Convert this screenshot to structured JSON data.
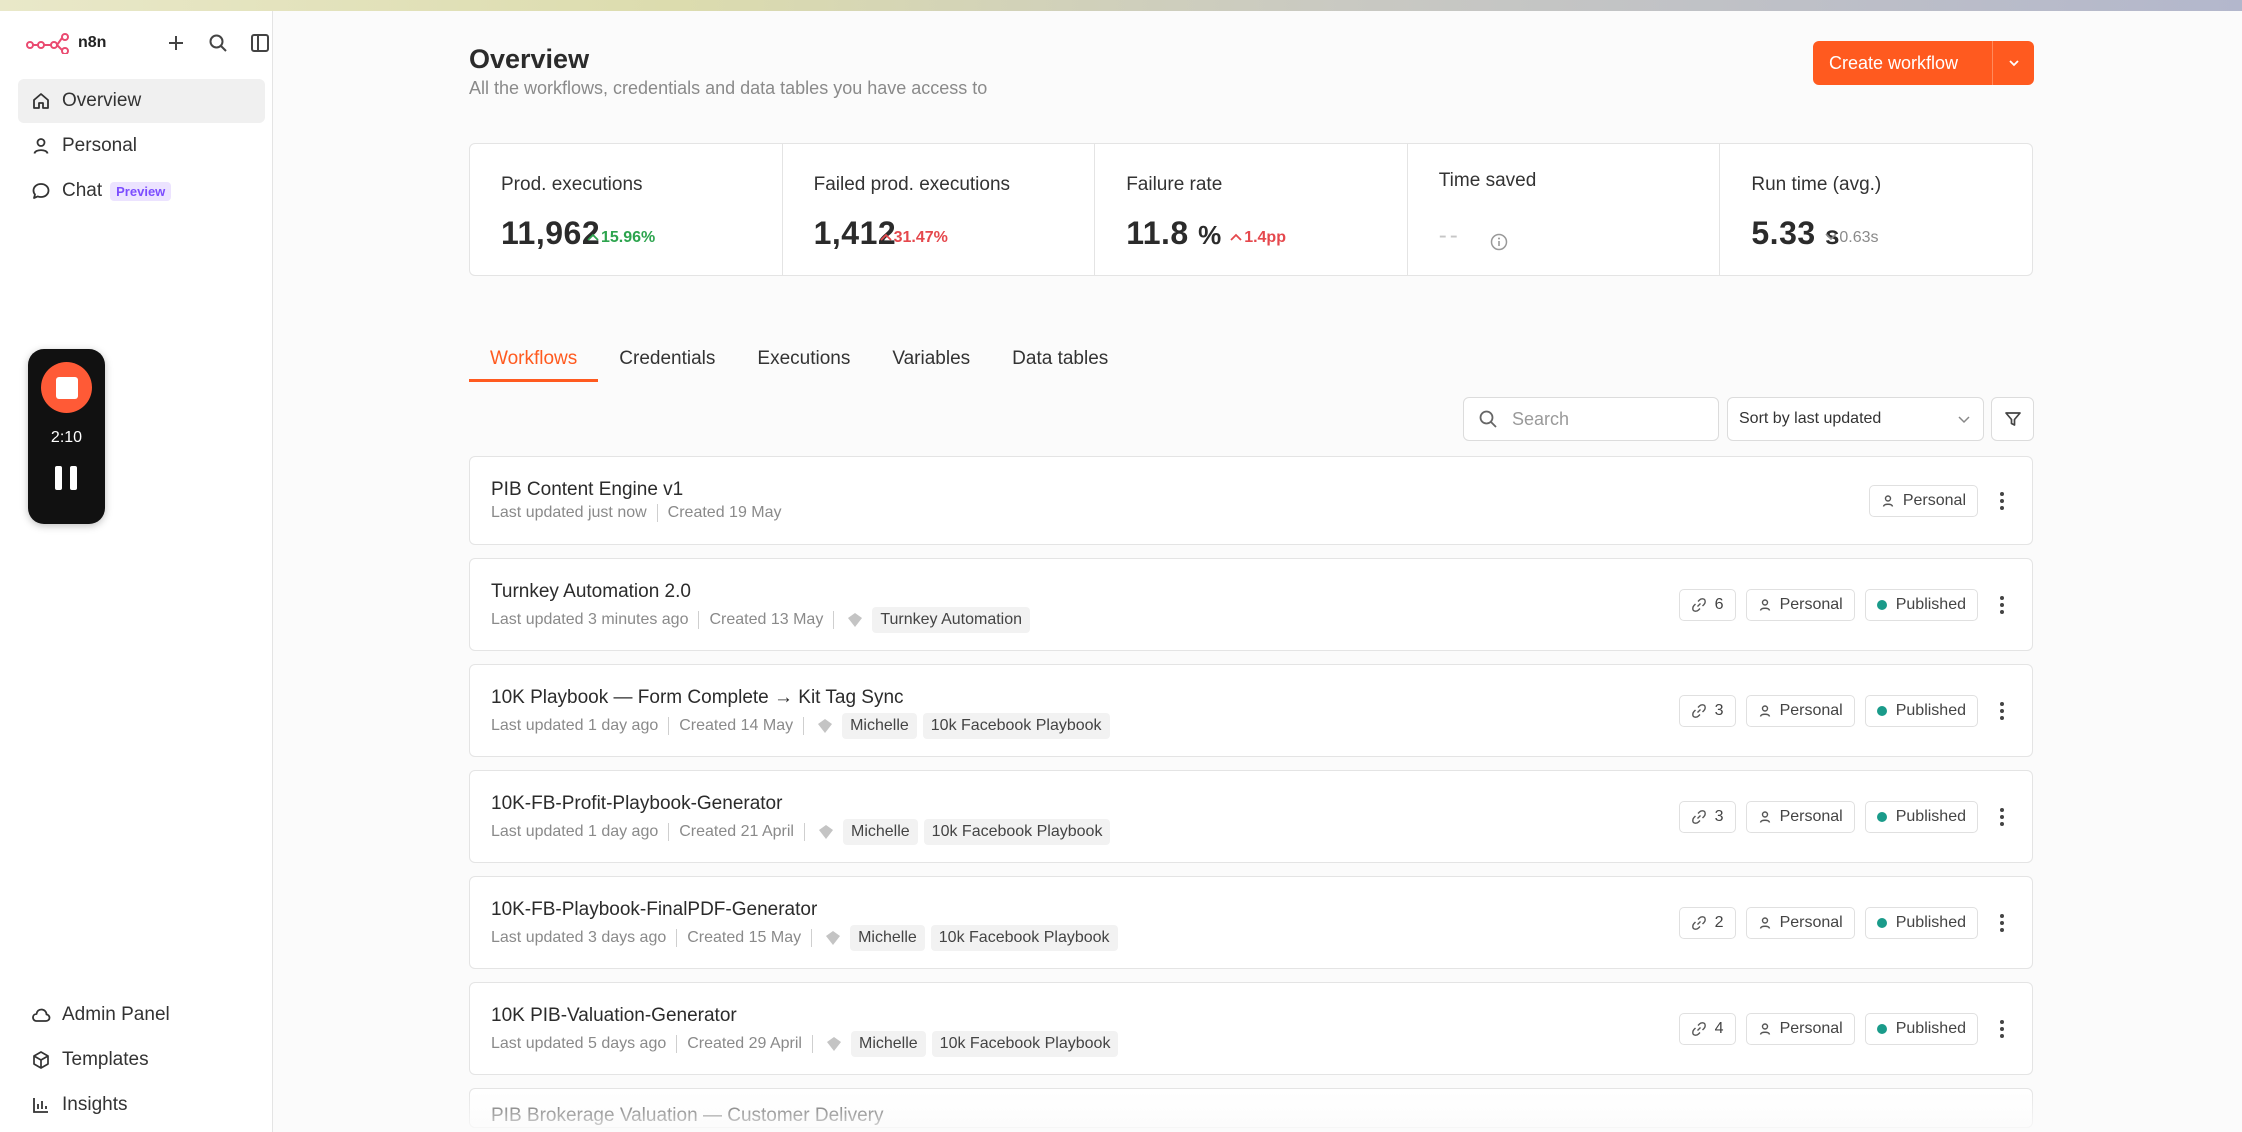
{
  "app": {
    "name": "n8n"
  },
  "sidebar": {
    "items": [
      {
        "label": "Overview",
        "icon": "home-icon"
      },
      {
        "label": "Personal",
        "icon": "user-icon"
      },
      {
        "label": "Chat",
        "icon": "chat-icon",
        "badge": "Preview"
      }
    ],
    "bottom_items": [
      {
        "label": "Admin Panel",
        "icon": "cloud-icon"
      },
      {
        "label": "Templates",
        "icon": "box-icon"
      },
      {
        "label": "Insights",
        "icon": "bar-chart-icon"
      }
    ]
  },
  "recorder": {
    "time": "2:10"
  },
  "header": {
    "title": "Overview",
    "subtitle": "All the workflows, credentials and data tables you have access to",
    "create_label": "Create workflow"
  },
  "stats": [
    {
      "label": "Prod. executions",
      "value": "11,962",
      "delta": "15.96%"
    },
    {
      "label": "Failed prod. executions",
      "value": "1,412",
      "delta": "31.47%"
    },
    {
      "label": "Failure rate",
      "value": "11.8",
      "unit": "%",
      "delta": "1.4pp"
    },
    {
      "label": "Time saved",
      "value": "--"
    },
    {
      "label": "Run time (avg.)",
      "value": "5.33",
      "unit": "s",
      "delta": "0.63s"
    }
  ],
  "tabs": [
    "Workflows",
    "Credentials",
    "Executions",
    "Variables",
    "Data tables"
  ],
  "toolbar": {
    "search_placeholder": "Search",
    "sort_label": "Sort by last updated"
  },
  "workflows": [
    {
      "title": "PIB Content Engine v1",
      "updated": "Last updated just now",
      "created": "Created 19 May",
      "owner": "Personal"
    },
    {
      "title": "Turnkey Automation 2.0",
      "updated": "Last updated 3 minutes ago",
      "created": "Created 13 May",
      "tags": [
        "Turnkey Automation"
      ],
      "links": "6",
      "owner": "Personal",
      "status": "Published"
    },
    {
      "title": "10K Playbook — Form Complete → Kit Tag Sync",
      "updated": "Last updated 1 day ago",
      "created": "Created 14 May",
      "tags": [
        "Michelle",
        "10k Facebook Playbook"
      ],
      "links": "3",
      "owner": "Personal",
      "status": "Published"
    },
    {
      "title": "10K-FB-Profit-Playbook-Generator",
      "updated": "Last updated 1 day ago",
      "created": "Created 21 April",
      "tags": [
        "Michelle",
        "10k Facebook Playbook"
      ],
      "links": "3",
      "owner": "Personal",
      "status": "Published"
    },
    {
      "title": "10K-FB-Playbook-FinalPDF-Generator",
      "updated": "Last updated 3 days ago",
      "created": "Created 15 May",
      "tags": [
        "Michelle",
        "10k Facebook Playbook"
      ],
      "links": "2",
      "owner": "Personal",
      "status": "Published"
    },
    {
      "title": "10K PIB-Valuation-Generator",
      "updated": "Last updated 5 days ago",
      "created": "Created 29 April",
      "tags": [
        "Michelle",
        "10k Facebook Playbook"
      ],
      "links": "4",
      "owner": "Personal",
      "status": "Published"
    },
    {
      "title": "PIB Brokerage Valuation — Customer Delivery"
    }
  ]
}
